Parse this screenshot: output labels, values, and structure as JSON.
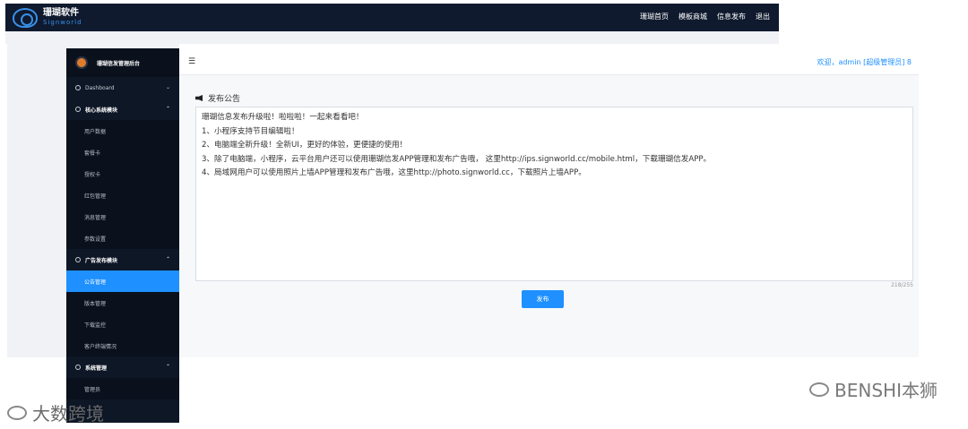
{
  "header": {
    "brand_cn": "珊瑚软件",
    "brand_en": "Signworld",
    "nav": [
      "珊瑚首页",
      "模板商城",
      "信息发布",
      "退出"
    ]
  },
  "sidebar": {
    "title": "珊瑚信发管理后台",
    "items": [
      {
        "label": "Dashboard",
        "type": "item",
        "chevron": "⌄"
      },
      {
        "label": "核心系统模块",
        "type": "group",
        "chevron": "⌃"
      },
      {
        "label": "用户数据",
        "type": "sub"
      },
      {
        "label": "套餐卡",
        "type": "sub"
      },
      {
        "label": "授权卡",
        "type": "sub"
      },
      {
        "label": "红包管理",
        "type": "sub"
      },
      {
        "label": "消息管理",
        "type": "sub"
      },
      {
        "label": "参数设置",
        "type": "sub"
      },
      {
        "label": "广告发布模块",
        "type": "group",
        "chevron": "⌃"
      },
      {
        "label": "公告管理",
        "type": "sub",
        "active": true
      },
      {
        "label": "版本管理",
        "type": "sub"
      },
      {
        "label": "下载监控",
        "type": "sub"
      },
      {
        "label": "客户终端情况",
        "type": "sub"
      },
      {
        "label": "系统管理",
        "type": "group",
        "chevron": "⌃"
      },
      {
        "label": "管理员",
        "type": "sub"
      }
    ]
  },
  "topbar": {
    "welcome": "欢迎，admin [超级管理员] 8"
  },
  "main": {
    "section_title": "发布公告",
    "announcement_lines": [
      "珊瑚信息发布升级啦！啦啦啦！一起来看看吧！",
      "1、小程序支持节目编辑啦！",
      "2、电脑端全新升级！全新UI，更好的体验，更便捷的使用！",
      "3、除了电脑端，小程序，云平台用户还可以使用珊瑚信发APP管理和发布广告哦，  这里http://ips.signworld.cc/mobile.html，下载珊瑚信发APP。",
      "4、局域网用户可以使用照片上墙APP管理和发布广告哦，这里http://photo.signworld.cc，下载照片上墙APP。"
    ],
    "char_counter": "218/255",
    "publish_label": "发布"
  },
  "watermarks": {
    "left": "大数跨境",
    "right": "BENSHI本狮"
  },
  "colors": {
    "accent": "#1e90ff",
    "sidebar_bg": "#0e1726",
    "header_bg": "#0f1a2e"
  }
}
